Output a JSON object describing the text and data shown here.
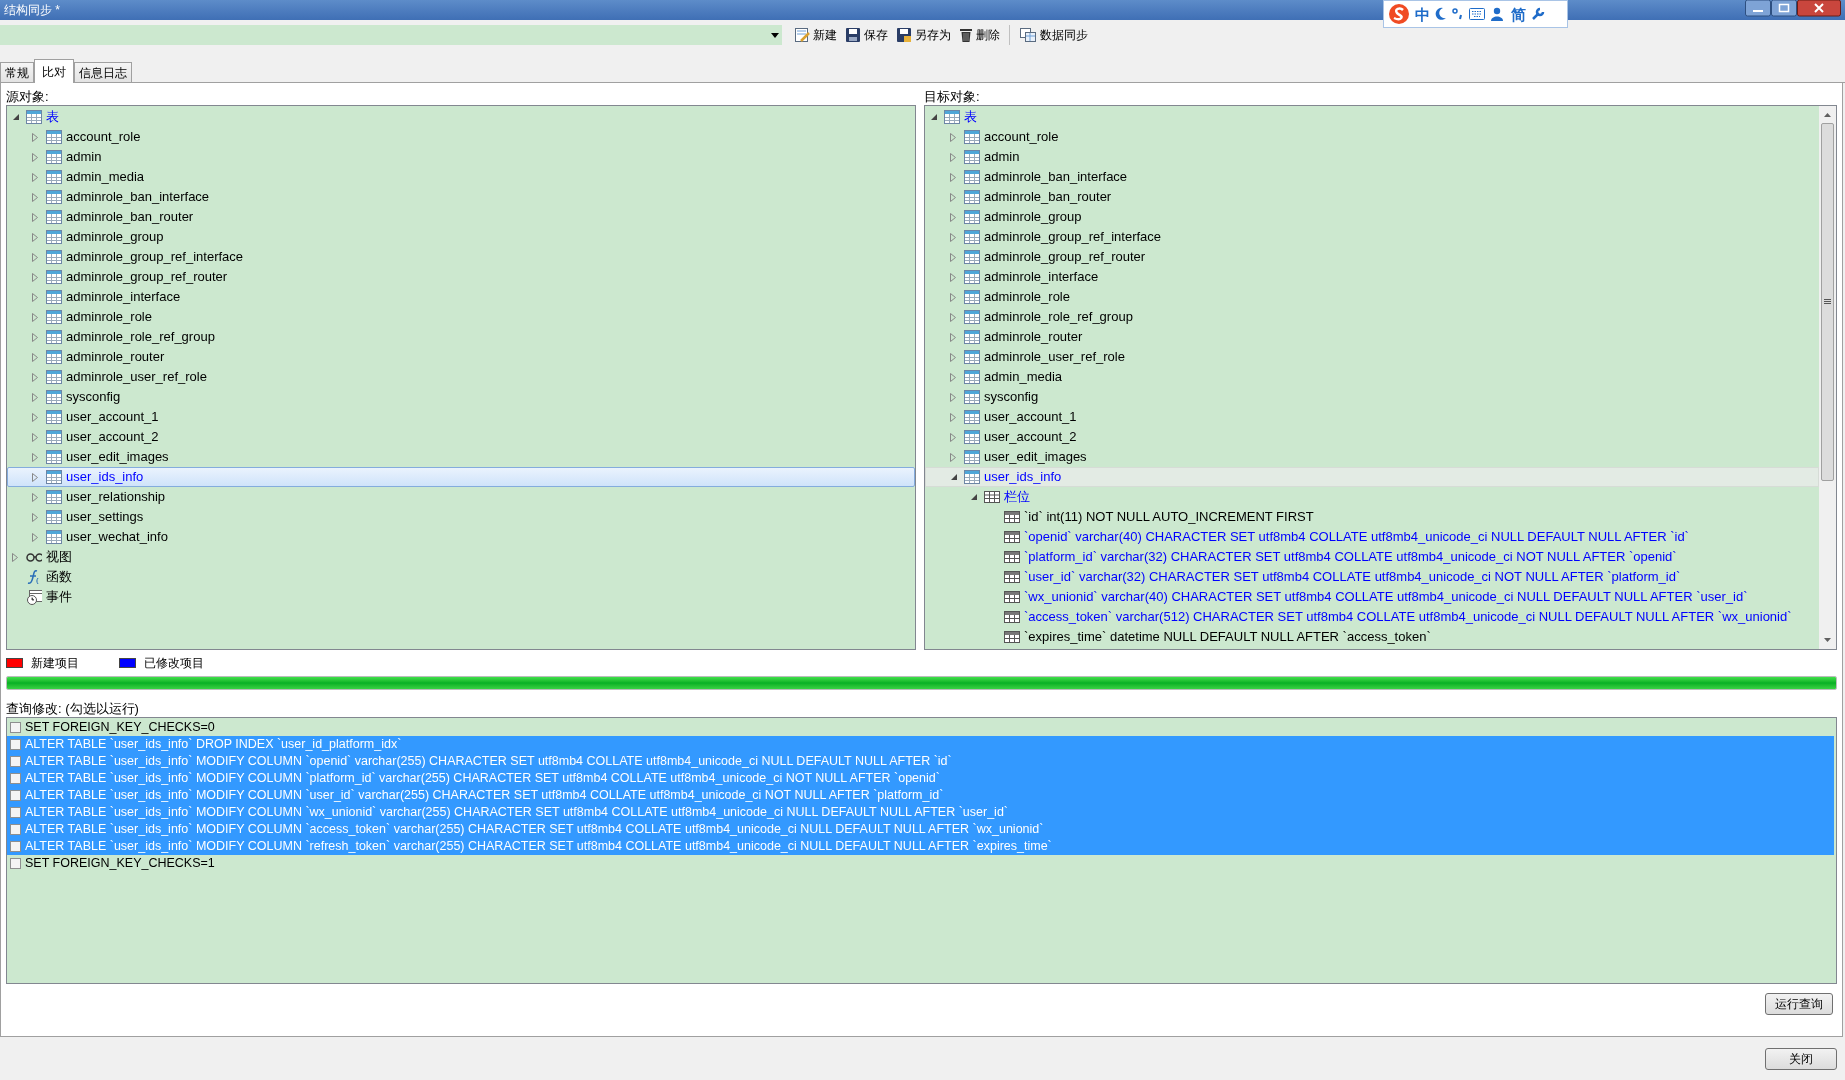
{
  "window": {
    "title": "结构同步 *"
  },
  "ime_toolbar": {
    "items": [
      {
        "kind": "logo"
      },
      {
        "kind": "text",
        "label": "中"
      },
      {
        "kind": "moon"
      },
      {
        "kind": "punct"
      },
      {
        "kind": "keyboard"
      },
      {
        "kind": "user"
      },
      {
        "kind": "text",
        "label": "简"
      },
      {
        "kind": "wrench"
      }
    ]
  },
  "toolbar": {
    "buttons": [
      {
        "label": "新建",
        "kind": "new"
      },
      {
        "label": "保存",
        "kind": "save"
      },
      {
        "label": "另存为",
        "kind": "saveas"
      },
      {
        "label": "删除",
        "kind": "delete"
      },
      {
        "label": "数据同步",
        "kind": "sync"
      }
    ]
  },
  "tabs": [
    {
      "label": "常规",
      "selected": false
    },
    {
      "label": "比对",
      "selected": true
    },
    {
      "label": "信息日志",
      "selected": false
    }
  ],
  "source": {
    "label": "源对象:",
    "focused": true,
    "tree": [
      {
        "label": "表",
        "kind": "folder",
        "expanded": true,
        "selected": false,
        "modified": true,
        "children": [
          {
            "label": "account_role",
            "kind": "table",
            "expanded": false,
            "selected": false,
            "modified": false
          },
          {
            "label": "admin",
            "kind": "table",
            "expanded": false,
            "selected": false,
            "modified": false
          },
          {
            "label": "admin_media",
            "kind": "table",
            "expanded": false,
            "selected": false,
            "modified": false
          },
          {
            "label": "adminrole_ban_interface",
            "kind": "table",
            "expanded": false,
            "selected": false,
            "modified": false
          },
          {
            "label": "adminrole_ban_router",
            "kind": "table",
            "expanded": false,
            "selected": false,
            "modified": false
          },
          {
            "label": "adminrole_group",
            "kind": "table",
            "expanded": false,
            "selected": false,
            "modified": false
          },
          {
            "label": "adminrole_group_ref_interface",
            "kind": "table",
            "expanded": false,
            "selected": false,
            "modified": false
          },
          {
            "label": "adminrole_group_ref_router",
            "kind": "table",
            "expanded": false,
            "selected": false,
            "modified": false
          },
          {
            "label": "adminrole_interface",
            "kind": "table",
            "expanded": false,
            "selected": false,
            "modified": false
          },
          {
            "label": "adminrole_role",
            "kind": "table",
            "expanded": false,
            "selected": false,
            "modified": false
          },
          {
            "label": "adminrole_role_ref_group",
            "kind": "table",
            "expanded": false,
            "selected": false,
            "modified": false
          },
          {
            "label": "adminrole_router",
            "kind": "table",
            "expanded": false,
            "selected": false,
            "modified": false
          },
          {
            "label": "adminrole_user_ref_role",
            "kind": "table",
            "expanded": false,
            "selected": false,
            "modified": false
          },
          {
            "label": "sysconfig",
            "kind": "table",
            "expanded": false,
            "selected": false,
            "modified": false
          },
          {
            "label": "user_account_1",
            "kind": "table",
            "expanded": false,
            "selected": false,
            "modified": false
          },
          {
            "label": "user_account_2",
            "kind": "table",
            "expanded": false,
            "selected": false,
            "modified": false
          },
          {
            "label": "user_edit_images",
            "kind": "table",
            "expanded": false,
            "selected": false,
            "modified": false
          },
          {
            "label": "user_ids_info",
            "kind": "table",
            "expanded": false,
            "selected": true,
            "modified": true
          },
          {
            "label": "user_relationship",
            "kind": "table",
            "expanded": false,
            "selected": false,
            "modified": false
          },
          {
            "label": "user_settings",
            "kind": "table",
            "expanded": false,
            "selected": false,
            "modified": false
          },
          {
            "label": "user_wechat_info",
            "kind": "table",
            "expanded": false,
            "selected": false,
            "modified": false
          }
        ]
      },
      {
        "label": "视图",
        "kind": "view",
        "expanded": false,
        "selected": false,
        "modified": false
      },
      {
        "label": "函数",
        "kind": "function",
        "selected": false,
        "modified": false
      },
      {
        "label": "事件",
        "kind": "event",
        "selected": false,
        "modified": false
      }
    ]
  },
  "target": {
    "label": "目标对象:",
    "focused": false,
    "tree": [
      {
        "label": "表",
        "kind": "folder",
        "expanded": true,
        "selected": false,
        "modified": true,
        "children": [
          {
            "label": "account_role",
            "kind": "table",
            "expanded": false,
            "selected": false,
            "modified": false
          },
          {
            "label": "admin",
            "kind": "table",
            "expanded": false,
            "selected": false,
            "modified": false
          },
          {
            "label": "adminrole_ban_interface",
            "kind": "table",
            "expanded": false,
            "selected": false,
            "modified": false
          },
          {
            "label": "adminrole_ban_router",
            "kind": "table",
            "expanded": false,
            "selected": false,
            "modified": false
          },
          {
            "label": "adminrole_group",
            "kind": "table",
            "expanded": false,
            "selected": false,
            "modified": false
          },
          {
            "label": "adminrole_group_ref_interface",
            "kind": "table",
            "expanded": false,
            "selected": false,
            "modified": false
          },
          {
            "label": "adminrole_group_ref_router",
            "kind": "table",
            "expanded": false,
            "selected": false,
            "modified": false
          },
          {
            "label": "adminrole_interface",
            "kind": "table",
            "expanded": false,
            "selected": false,
            "modified": false
          },
          {
            "label": "adminrole_role",
            "kind": "table",
            "expanded": false,
            "selected": false,
            "modified": false
          },
          {
            "label": "adminrole_role_ref_group",
            "kind": "table",
            "expanded": false,
            "selected": false,
            "modified": false
          },
          {
            "label": "adminrole_router",
            "kind": "table",
            "expanded": false,
            "selected": false,
            "modified": false
          },
          {
            "label": "adminrole_user_ref_role",
            "kind": "table",
            "expanded": false,
            "selected": false,
            "modified": false
          },
          {
            "label": "admin_media",
            "kind": "table",
            "expanded": false,
            "selected": false,
            "modified": false
          },
          {
            "label": "sysconfig",
            "kind": "table",
            "expanded": false,
            "selected": false,
            "modified": false
          },
          {
            "label": "user_account_1",
            "kind": "table",
            "expanded": false,
            "selected": false,
            "modified": false
          },
          {
            "label": "user_account_2",
            "kind": "table",
            "expanded": false,
            "selected": false,
            "modified": false
          },
          {
            "label": "user_edit_images",
            "kind": "table",
            "expanded": false,
            "selected": false,
            "modified": false
          },
          {
            "label": "user_ids_info",
            "kind": "table",
            "expanded": true,
            "selected": true,
            "modified": true,
            "children": [
              {
                "label": "栏位",
                "kind": "columns",
                "expanded": true,
                "selected": false,
                "modified": true,
                "children": [
                  {
                    "label": "`id`  int(11) NOT NULL AUTO_INCREMENT FIRST",
                    "kind": "column",
                    "selected": false,
                    "modified": false
                  },
                  {
                    "label": "`openid`  varchar(40) CHARACTER SET utf8mb4 COLLATE utf8mb4_unicode_ci NULL DEFAULT NULL AFTER `id`",
                    "kind": "column",
                    "selected": false,
                    "modified": true
                  },
                  {
                    "label": "`platform_id`  varchar(32) CHARACTER SET utf8mb4 COLLATE utf8mb4_unicode_ci NOT NULL AFTER `openid`",
                    "kind": "column",
                    "selected": false,
                    "modified": true
                  },
                  {
                    "label": "`user_id`  varchar(32) CHARACTER SET utf8mb4 COLLATE utf8mb4_unicode_ci NOT NULL AFTER `platform_id`",
                    "kind": "column",
                    "selected": false,
                    "modified": true
                  },
                  {
                    "label": "`wx_unionid`  varchar(40) CHARACTER SET utf8mb4 COLLATE utf8mb4_unicode_ci NULL DEFAULT NULL AFTER `user_id`",
                    "kind": "column",
                    "selected": false,
                    "modified": true
                  },
                  {
                    "label": "`access_token`  varchar(512) CHARACTER SET utf8mb4 COLLATE utf8mb4_unicode_ci NULL DEFAULT NULL AFTER `wx_unionid`",
                    "kind": "column",
                    "selected": false,
                    "modified": true
                  },
                  {
                    "label": "`expires_time`  datetime NULL DEFAULT NULL AFTER `access_token`",
                    "kind": "column",
                    "selected": false,
                    "modified": false
                  }
                ]
              }
            ]
          }
        ]
      }
    ]
  },
  "legend": [
    {
      "label": "新建项目",
      "color": "#ff0000"
    },
    {
      "label": "已修改项目",
      "color": "#0000ff"
    }
  ],
  "progress": {
    "level": 1
  },
  "queries": {
    "label": "查询修改: (勾选以运行)",
    "items": [
      {
        "sql": "SET FOREIGN_KEY_CHECKS=0",
        "checked": false,
        "selected": false
      },
      {
        "sql": "ALTER TABLE `user_ids_info` DROP INDEX `user_id_platform_idx`",
        "checked": false,
        "selected": true
      },
      {
        "sql": "ALTER TABLE `user_ids_info` MODIFY COLUMN `openid`  varchar(255) CHARACTER SET utf8mb4 COLLATE utf8mb4_unicode_ci NULL DEFAULT NULL AFTER `id`",
        "checked": false,
        "selected": true
      },
      {
        "sql": "ALTER TABLE `user_ids_info` MODIFY COLUMN `platform_id`  varchar(255) CHARACTER SET utf8mb4 COLLATE utf8mb4_unicode_ci NOT NULL AFTER `openid`",
        "checked": false,
        "selected": true
      },
      {
        "sql": "ALTER TABLE `user_ids_info` MODIFY COLUMN `user_id`  varchar(255) CHARACTER SET utf8mb4 COLLATE utf8mb4_unicode_ci NOT NULL AFTER `platform_id`",
        "checked": false,
        "selected": true
      },
      {
        "sql": "ALTER TABLE `user_ids_info` MODIFY COLUMN `wx_unionid`  varchar(255) CHARACTER SET utf8mb4 COLLATE utf8mb4_unicode_ci NULL DEFAULT NULL AFTER `user_id`",
        "checked": false,
        "selected": true
      },
      {
        "sql": "ALTER TABLE `user_ids_info` MODIFY COLUMN `access_token`  varchar(255) CHARACTER SET utf8mb4 COLLATE utf8mb4_unicode_ci NULL DEFAULT NULL AFTER `wx_unionid`",
        "checked": false,
        "selected": true
      },
      {
        "sql": "ALTER TABLE `user_ids_info` MODIFY COLUMN `refresh_token`  varchar(255) CHARACTER SET utf8mb4 COLLATE utf8mb4_unicode_ci NULL DEFAULT NULL AFTER `expires_time`",
        "checked": false,
        "selected": true
      },
      {
        "sql": "SET FOREIGN_KEY_CHECKS=1",
        "checked": false,
        "selected": false
      }
    ]
  },
  "run_button": {
    "label": "运行查询"
  },
  "close_button": {
    "label": "关闭"
  }
}
